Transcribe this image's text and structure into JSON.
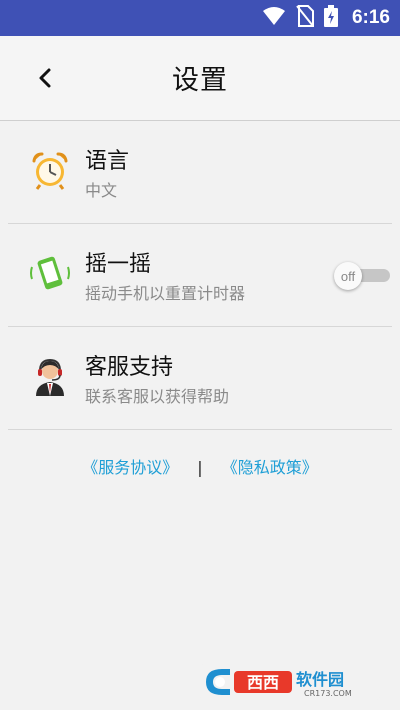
{
  "status_bar": {
    "time": "6:16",
    "icons": [
      "wifi-icon",
      "no-sim-icon",
      "battery-charging-icon"
    ],
    "background_color": "#3f51b5"
  },
  "toolbar": {
    "title": "设置",
    "back_icon": "chevron-left-icon"
  },
  "settings": {
    "language": {
      "icon": "alarm-clock-icon",
      "title": "语言",
      "subtitle": "中文"
    },
    "shake": {
      "icon": "shake-phone-icon",
      "title": "摇一摇",
      "subtitle": "摇动手机以重置计时器",
      "toggle_label": "off",
      "toggle_on": false
    },
    "support": {
      "icon": "customer-service-icon",
      "title": "客服支持",
      "subtitle": "联系客服以获得帮助"
    }
  },
  "links": {
    "terms": "《服务协议》",
    "separator": "|",
    "privacy": "《隐私政策》",
    "color": "#1f9fd6"
  },
  "watermark": {
    "brand": "西西软件园",
    "url": "CR173.COM"
  }
}
